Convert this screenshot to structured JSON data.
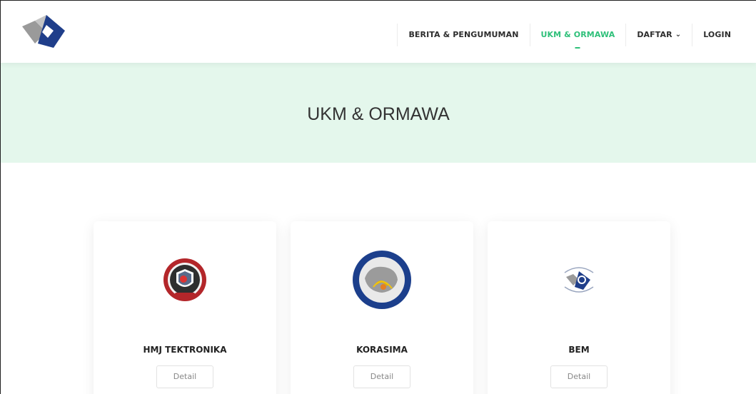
{
  "header": {
    "logo_icon": "campus-diamond-logo",
    "nav": [
      {
        "label": "BERITA & PENGUMUMAN",
        "active": false
      },
      {
        "label": "UKM & ORMAWA",
        "active": true
      },
      {
        "label": "DAFTAR",
        "active": false,
        "has_dropdown": true
      },
      {
        "label": "LOGIN",
        "active": false
      }
    ],
    "dropdown_caret": "⌄"
  },
  "banner": {
    "title": "UKM & ORMAWA",
    "background": "#e4f7ec"
  },
  "colors": {
    "accent": "#2fc07a",
    "text": "#2d2d2d"
  },
  "cards": [
    {
      "name": "HMJ TEKTRONIKA",
      "button": "Detail",
      "logo_icon": "hmj-tektronika-emblem"
    },
    {
      "name": "KORASIMA",
      "button": "Detail",
      "logo_icon": "korasima-emblem"
    },
    {
      "name": "BEM",
      "button": "Detail",
      "logo_icon": "bem-emblem"
    }
  ]
}
